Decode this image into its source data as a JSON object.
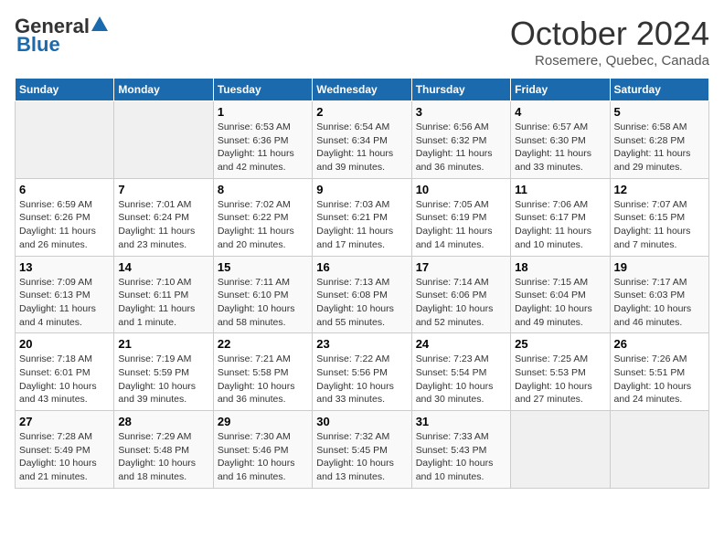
{
  "header": {
    "logo_general": "General",
    "logo_blue": "Blue",
    "month": "October 2024",
    "location": "Rosemere, Quebec, Canada"
  },
  "days_of_week": [
    "Sunday",
    "Monday",
    "Tuesday",
    "Wednesday",
    "Thursday",
    "Friday",
    "Saturday"
  ],
  "weeks": [
    [
      {
        "day": "",
        "sunrise": "",
        "sunset": "",
        "daylight": ""
      },
      {
        "day": "",
        "sunrise": "",
        "sunset": "",
        "daylight": ""
      },
      {
        "day": "1",
        "sunrise": "Sunrise: 6:53 AM",
        "sunset": "Sunset: 6:36 PM",
        "daylight": "Daylight: 11 hours and 42 minutes."
      },
      {
        "day": "2",
        "sunrise": "Sunrise: 6:54 AM",
        "sunset": "Sunset: 6:34 PM",
        "daylight": "Daylight: 11 hours and 39 minutes."
      },
      {
        "day": "3",
        "sunrise": "Sunrise: 6:56 AM",
        "sunset": "Sunset: 6:32 PM",
        "daylight": "Daylight: 11 hours and 36 minutes."
      },
      {
        "day": "4",
        "sunrise": "Sunrise: 6:57 AM",
        "sunset": "Sunset: 6:30 PM",
        "daylight": "Daylight: 11 hours and 33 minutes."
      },
      {
        "day": "5",
        "sunrise": "Sunrise: 6:58 AM",
        "sunset": "Sunset: 6:28 PM",
        "daylight": "Daylight: 11 hours and 29 minutes."
      }
    ],
    [
      {
        "day": "6",
        "sunrise": "Sunrise: 6:59 AM",
        "sunset": "Sunset: 6:26 PM",
        "daylight": "Daylight: 11 hours and 26 minutes."
      },
      {
        "day": "7",
        "sunrise": "Sunrise: 7:01 AM",
        "sunset": "Sunset: 6:24 PM",
        "daylight": "Daylight: 11 hours and 23 minutes."
      },
      {
        "day": "8",
        "sunrise": "Sunrise: 7:02 AM",
        "sunset": "Sunset: 6:22 PM",
        "daylight": "Daylight: 11 hours and 20 minutes."
      },
      {
        "day": "9",
        "sunrise": "Sunrise: 7:03 AM",
        "sunset": "Sunset: 6:21 PM",
        "daylight": "Daylight: 11 hours and 17 minutes."
      },
      {
        "day": "10",
        "sunrise": "Sunrise: 7:05 AM",
        "sunset": "Sunset: 6:19 PM",
        "daylight": "Daylight: 11 hours and 14 minutes."
      },
      {
        "day": "11",
        "sunrise": "Sunrise: 7:06 AM",
        "sunset": "Sunset: 6:17 PM",
        "daylight": "Daylight: 11 hours and 10 minutes."
      },
      {
        "day": "12",
        "sunrise": "Sunrise: 7:07 AM",
        "sunset": "Sunset: 6:15 PM",
        "daylight": "Daylight: 11 hours and 7 minutes."
      }
    ],
    [
      {
        "day": "13",
        "sunrise": "Sunrise: 7:09 AM",
        "sunset": "Sunset: 6:13 PM",
        "daylight": "Daylight: 11 hours and 4 minutes."
      },
      {
        "day": "14",
        "sunrise": "Sunrise: 7:10 AM",
        "sunset": "Sunset: 6:11 PM",
        "daylight": "Daylight: 11 hours and 1 minute."
      },
      {
        "day": "15",
        "sunrise": "Sunrise: 7:11 AM",
        "sunset": "Sunset: 6:10 PM",
        "daylight": "Daylight: 10 hours and 58 minutes."
      },
      {
        "day": "16",
        "sunrise": "Sunrise: 7:13 AM",
        "sunset": "Sunset: 6:08 PM",
        "daylight": "Daylight: 10 hours and 55 minutes."
      },
      {
        "day": "17",
        "sunrise": "Sunrise: 7:14 AM",
        "sunset": "Sunset: 6:06 PM",
        "daylight": "Daylight: 10 hours and 52 minutes."
      },
      {
        "day": "18",
        "sunrise": "Sunrise: 7:15 AM",
        "sunset": "Sunset: 6:04 PM",
        "daylight": "Daylight: 10 hours and 49 minutes."
      },
      {
        "day": "19",
        "sunrise": "Sunrise: 7:17 AM",
        "sunset": "Sunset: 6:03 PM",
        "daylight": "Daylight: 10 hours and 46 minutes."
      }
    ],
    [
      {
        "day": "20",
        "sunrise": "Sunrise: 7:18 AM",
        "sunset": "Sunset: 6:01 PM",
        "daylight": "Daylight: 10 hours and 43 minutes."
      },
      {
        "day": "21",
        "sunrise": "Sunrise: 7:19 AM",
        "sunset": "Sunset: 5:59 PM",
        "daylight": "Daylight: 10 hours and 39 minutes."
      },
      {
        "day": "22",
        "sunrise": "Sunrise: 7:21 AM",
        "sunset": "Sunset: 5:58 PM",
        "daylight": "Daylight: 10 hours and 36 minutes."
      },
      {
        "day": "23",
        "sunrise": "Sunrise: 7:22 AM",
        "sunset": "Sunset: 5:56 PM",
        "daylight": "Daylight: 10 hours and 33 minutes."
      },
      {
        "day": "24",
        "sunrise": "Sunrise: 7:23 AM",
        "sunset": "Sunset: 5:54 PM",
        "daylight": "Daylight: 10 hours and 30 minutes."
      },
      {
        "day": "25",
        "sunrise": "Sunrise: 7:25 AM",
        "sunset": "Sunset: 5:53 PM",
        "daylight": "Daylight: 10 hours and 27 minutes."
      },
      {
        "day": "26",
        "sunrise": "Sunrise: 7:26 AM",
        "sunset": "Sunset: 5:51 PM",
        "daylight": "Daylight: 10 hours and 24 minutes."
      }
    ],
    [
      {
        "day": "27",
        "sunrise": "Sunrise: 7:28 AM",
        "sunset": "Sunset: 5:49 PM",
        "daylight": "Daylight: 10 hours and 21 minutes."
      },
      {
        "day": "28",
        "sunrise": "Sunrise: 7:29 AM",
        "sunset": "Sunset: 5:48 PM",
        "daylight": "Daylight: 10 hours and 18 minutes."
      },
      {
        "day": "29",
        "sunrise": "Sunrise: 7:30 AM",
        "sunset": "Sunset: 5:46 PM",
        "daylight": "Daylight: 10 hours and 16 minutes."
      },
      {
        "day": "30",
        "sunrise": "Sunrise: 7:32 AM",
        "sunset": "Sunset: 5:45 PM",
        "daylight": "Daylight: 10 hours and 13 minutes."
      },
      {
        "day": "31",
        "sunrise": "Sunrise: 7:33 AM",
        "sunset": "Sunset: 5:43 PM",
        "daylight": "Daylight: 10 hours and 10 minutes."
      },
      {
        "day": "",
        "sunrise": "",
        "sunset": "",
        "daylight": ""
      },
      {
        "day": "",
        "sunrise": "",
        "sunset": "",
        "daylight": ""
      }
    ]
  ]
}
